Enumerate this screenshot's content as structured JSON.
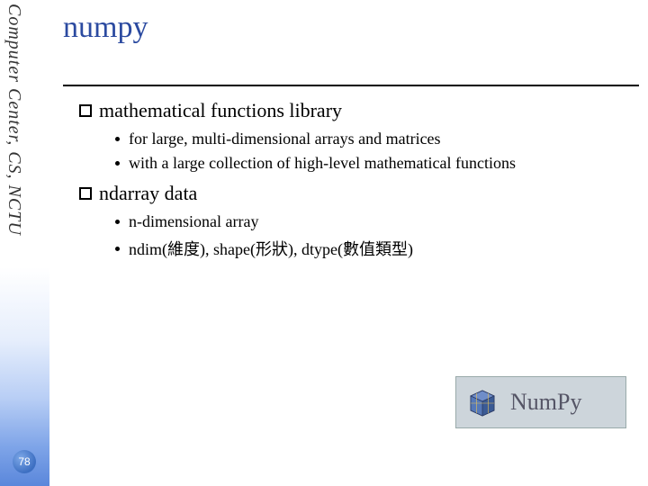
{
  "sidebar": {
    "org_text": "Computer Center, CS, NCTU"
  },
  "page_number": "78",
  "title": "numpy",
  "sections": [
    {
      "heading": "mathematical functions library",
      "items": [
        "for large, multi-dimensional arrays and matrices",
        "with a large collection of high-level mathematical functions"
      ]
    },
    {
      "heading": "ndarray data",
      "items": [
        "n-dimensional array",
        "ndim(維度), shape(形狀), dtype(數值類型)"
      ]
    }
  ],
  "logo": {
    "text": "NumPy"
  }
}
